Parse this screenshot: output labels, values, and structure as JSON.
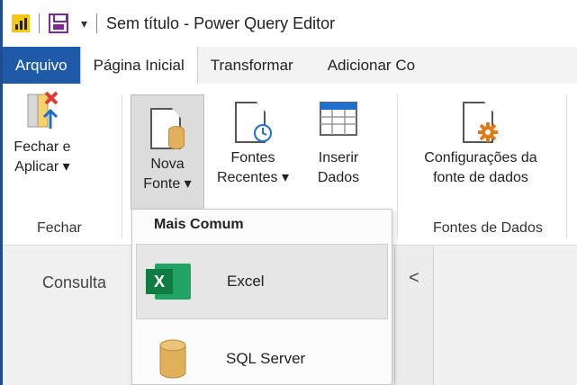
{
  "window": {
    "title": "Sem título - Power Query Editor",
    "quick_access_dropdown": "▾"
  },
  "tabs": [
    {
      "label": "Arquivo"
    },
    {
      "label": "Página Inicial"
    },
    {
      "label": "Transformar"
    },
    {
      "label": "Adicionar Co"
    }
  ],
  "ribbon": {
    "close_apply": {
      "line1": "Fechar e",
      "line2": "Aplicar ▾"
    },
    "new_source": {
      "line1": "Nova",
      "line2": "Fonte ▾"
    },
    "recent_sources": {
      "line1": "Fontes",
      "line2": "Recentes ▾"
    },
    "enter_data": {
      "line1": "Inserir",
      "line2": "Dados"
    },
    "data_source_settings": {
      "line1": "Configurações da",
      "line2": "fonte de dados"
    },
    "groups": {
      "close": "Fechar",
      "data_sources": "Fontes de Dados"
    }
  },
  "dropdown": {
    "header": "Mais Comum",
    "items": [
      {
        "label": "Excel",
        "icon": "excel-icon"
      },
      {
        "label": "SQL Server",
        "icon": "database-icon"
      }
    ]
  },
  "queries_pane": {
    "label": "Consulta",
    "collapse_glyph": "<"
  },
  "colors": {
    "file_tab": "#1e5aa8",
    "window_border": "#1e4d92",
    "excel_green": "#107c41",
    "database_gold": "#e0b15a",
    "source_settings_orange": "#e07b1a",
    "close_red": "#e03a3a"
  }
}
